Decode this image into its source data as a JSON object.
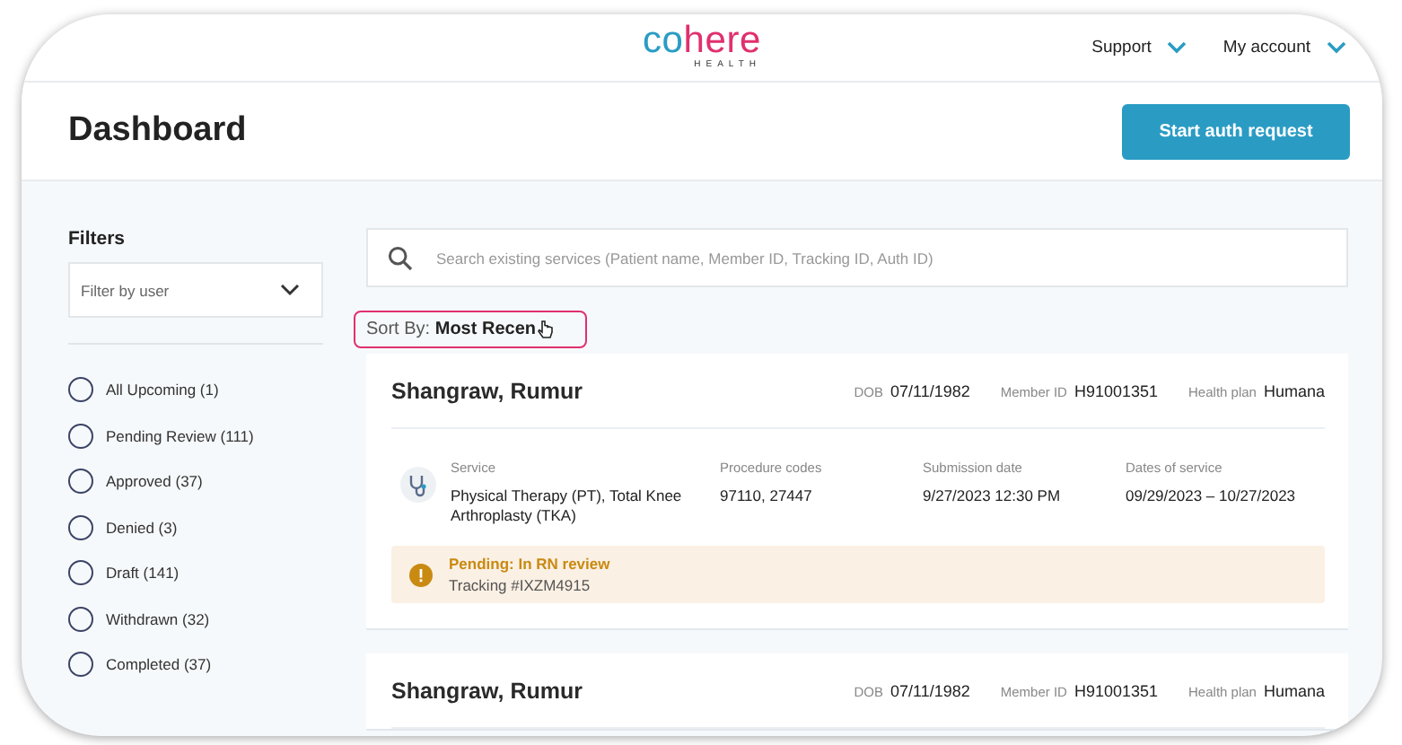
{
  "header": {
    "logo": {
      "first": "co",
      "second": "here",
      "tagline": "HEALTH"
    },
    "menus": [
      "Support",
      "My account"
    ]
  },
  "page": {
    "title": "Dashboard",
    "primary_button": "Start auth request"
  },
  "filters": {
    "title": "Filters",
    "user_select": {
      "placeholder": "Filter by user"
    },
    "statuses": [
      {
        "label": "All Upcoming (1)",
        "selected": false
      },
      {
        "label": "Pending Review (111)",
        "selected": false
      },
      {
        "label": "Approved (37)",
        "selected": false
      },
      {
        "label": "Denied (3)",
        "selected": false
      },
      {
        "label": "Draft (141)",
        "selected": false
      },
      {
        "label": "Withdrawn (32)",
        "selected": false
      },
      {
        "label": "Completed (37)",
        "selected": false
      }
    ]
  },
  "search": {
    "placeholder": "Search existing services (Patient name, Member ID, Tracking ID, Auth ID)"
  },
  "sort": {
    "label": "Sort By:",
    "value": "Most Recen"
  },
  "cards": [
    {
      "patient": "Shangraw, Rumur",
      "dob_label": "DOB",
      "dob": "07/11/1982",
      "member_label": "Member ID",
      "member_id": "H91001351",
      "plan_label": "Health plan",
      "plan": "Humana",
      "details": [
        {
          "label": "Service",
          "value": "Physical Therapy (PT), Total Knee Arthroplasty (TKA)"
        },
        {
          "label": "Procedure codes",
          "value": "97110, 27447"
        },
        {
          "label": "Submission date",
          "value": "9/27/2023 12:30 PM"
        },
        {
          "label": "Dates of service",
          "value": "09/29/2023 – 10/27/2023"
        }
      ],
      "status": {
        "kind": "pending",
        "title": "Pending: In RN review",
        "tracking": "Tracking #IXZM4915"
      }
    },
    {
      "patient": "Shangraw, Rumur",
      "dob_label": "DOB",
      "dob": "07/11/1982",
      "member_label": "Member ID",
      "member_id": "H91001351",
      "plan_label": "Health plan",
      "plan": "Humana"
    }
  ]
}
